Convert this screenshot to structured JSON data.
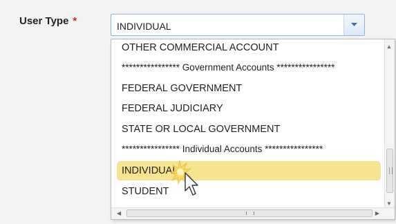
{
  "field": {
    "label": "User Type",
    "required_mark": "*"
  },
  "select": {
    "value": "INDIVIDUAL",
    "arrow_icon": "chevron-down-icon"
  },
  "options": [
    {
      "label": "OTHER COMMERCIAL ACCOUNT",
      "type": "option"
    },
    {
      "label": "**************** Government Accounts ****************",
      "type": "separator"
    },
    {
      "label": "FEDERAL GOVERNMENT",
      "type": "option"
    },
    {
      "label": "FEDERAL JUDICIARY",
      "type": "option"
    },
    {
      "label": "STATE OR LOCAL GOVERNMENT",
      "type": "option"
    },
    {
      "label": "**************** Individual Accounts ****************",
      "type": "separator"
    },
    {
      "label": "INDIVIDUAL",
      "type": "option",
      "selected": true
    },
    {
      "label": "STUDENT",
      "type": "option"
    }
  ],
  "colors": {
    "required": "#d9261c",
    "selected_option": "#f6e48f",
    "select_border": "#8fb2dd"
  },
  "scrollbars": {
    "horizontal_grip": "III",
    "vertical_grip": "III"
  }
}
